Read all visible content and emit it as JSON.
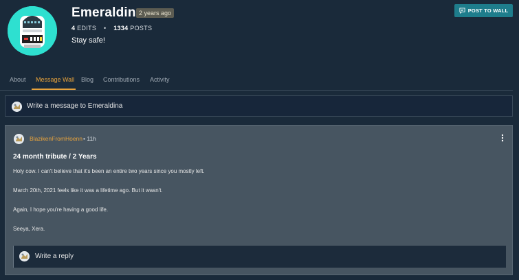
{
  "profile": {
    "username": "Emeraldina",
    "age_badge": "2 years ago",
    "edits_count": "4",
    "edits_label": "EDITS",
    "posts_count": "1334",
    "posts_label": "POSTS",
    "separator": "•",
    "bio": "Stay safe!",
    "avatar_icon": "robot-avatar-icon"
  },
  "header": {
    "post_to_wall_label": "POST TO WALL",
    "post_to_wall_icon": "message-icon"
  },
  "tabs": [
    {
      "label": "About"
    },
    {
      "label": "Message Wall"
    },
    {
      "label": "Blog"
    },
    {
      "label": "Contributions"
    },
    {
      "label": "Activity"
    }
  ],
  "active_tab": "Message Wall",
  "composer": {
    "placeholder": "Write a message to Emeraldina"
  },
  "post": {
    "author": "BlazikenFromHoenn",
    "time_separator": "•",
    "time": "11h",
    "title": "24 month tribute / 2 Years",
    "paragraphs": [
      "Holy cow. I can't believe that it's been an entire two years since you mostly left.",
      "March 20th, 2021 feels like it was a lifetime ago. But it wasn't.",
      "Again, I hope you're having a good life.",
      "Seeya, Xera."
    ],
    "reply_placeholder": "Write a reply",
    "more_icon": "more-vertical-icon"
  },
  "colors": {
    "background": "#1a2a3a",
    "accent": "#e8a33c",
    "button": "#1e7d8c",
    "card": "#475561"
  }
}
